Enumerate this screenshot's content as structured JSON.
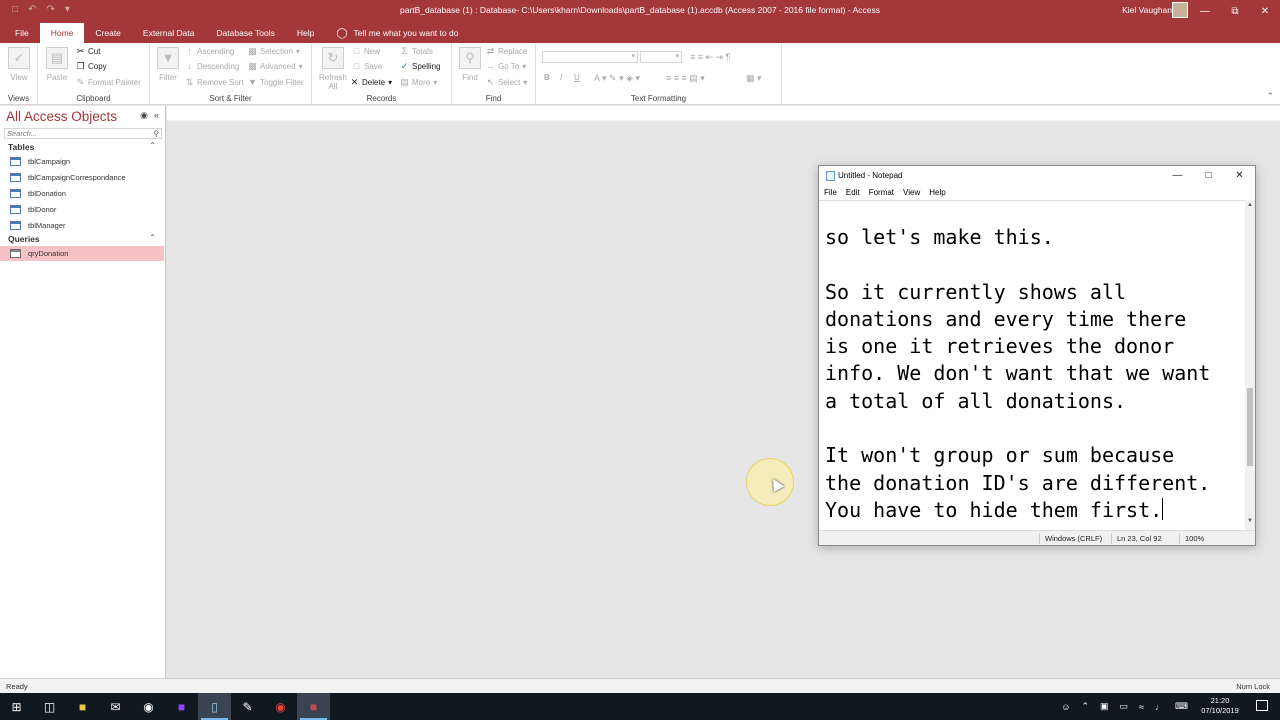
{
  "app": {
    "window_title": "partB_database (1) : Database- C:\\Users\\kharn\\Downloads\\partB_database (1).accdb (Access 2007 - 2016 file format) - Access",
    "user_name": "Kiel Vaughan"
  },
  "tabs": [
    {
      "label": "File"
    },
    {
      "label": "Home",
      "active": true
    },
    {
      "label": "Create"
    },
    {
      "label": "External Data"
    },
    {
      "label": "Database Tools"
    },
    {
      "label": "Help"
    },
    {
      "label": "Tell me what you want to do"
    }
  ],
  "ribbon": {
    "views": {
      "label": "Views",
      "view": "View"
    },
    "clipboard": {
      "label": "Clipboard",
      "paste": "Paste",
      "cut": "Cut",
      "copy": "Copy",
      "format_painter": "Format Painter"
    },
    "sort_filter": {
      "label": "Sort & Filter",
      "filter": "Filter",
      "ascending": "Ascending",
      "descending": "Descending",
      "remove_sort": "Remove Sort",
      "selection": "Selection",
      "advanced": "Advanced",
      "toggle_filter": "Toggle Filter"
    },
    "records": {
      "label": "Records",
      "refresh": "Refresh",
      "refresh_all": "All",
      "new": "New",
      "save": "Save",
      "delete": "Delete",
      "totals": "Totals",
      "spelling": "Spelling",
      "more": "More"
    },
    "find": {
      "label": "Find",
      "find": "Find",
      "replace": "Replace",
      "go_to": "Go To",
      "select": "Select"
    },
    "text_formatting": {
      "label": "Text Formatting",
      "bold": "B",
      "italic": "I",
      "underline": "U"
    }
  },
  "nav": {
    "title": "All Access Objects",
    "search_placeholder": "Search...",
    "sections": [
      {
        "name": "Tables",
        "items": [
          "tblCampaign",
          "tblCampaignCorrespondance",
          "tblDonation",
          "tblDonor",
          "tblManager"
        ]
      },
      {
        "name": "Queries",
        "items": [
          "qryDonation"
        ],
        "selected": "qryDonation"
      }
    ]
  },
  "status": {
    "left": "Ready",
    "right": "Num Lock"
  },
  "notepad": {
    "title": "Untitled - Notepad",
    "menu": [
      "File",
      "Edit",
      "Format",
      "View",
      "Help"
    ],
    "text": "so let's make this.\n\nSo it currently shows all\ndonations and every time there\nis one it retrieves the donor\ninfo. We don't want that we want\na total of all donations.\n\nIt won't group or sum because\nthe donation ID's are different.\nYou have to hide them first.",
    "status_encoding": "Windows (CRLF)",
    "status_position": "Ln 23, Col 92",
    "status_zoom": "100%"
  },
  "taskbar": {
    "clock_time": "21:20",
    "clock_date": "07/10/2019"
  },
  "colors": {
    "access_brand": "#a4373a",
    "selected_item": "#f7c2c5"
  }
}
